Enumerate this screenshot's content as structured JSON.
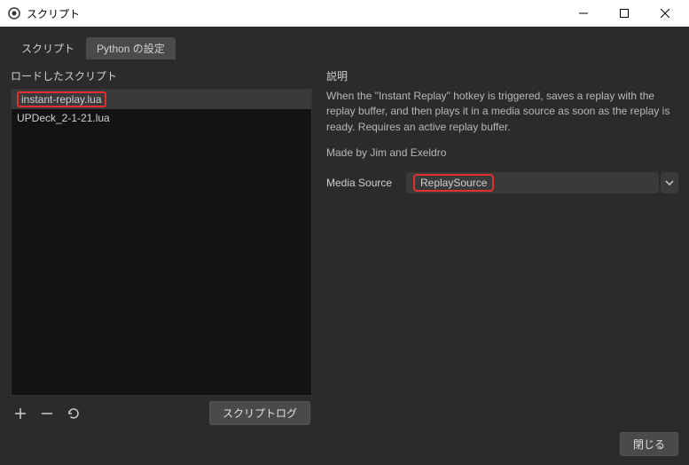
{
  "window": {
    "title": "スクリプト"
  },
  "tabs": {
    "scripts": "スクリプト",
    "python": "Python の設定"
  },
  "left": {
    "label": "ロードしたスクリプト",
    "items": [
      "instant-replay.lua",
      "UPDeck_2-1-21.lua"
    ]
  },
  "right": {
    "label": "説明",
    "description1": "When the \"Instant Replay\" hotkey is triggered, saves a replay with the replay buffer, and then plays it in a media source as soon as the replay is ready.  Requires an active replay buffer.",
    "description2": "Made by Jim and Exeldro",
    "mediaSource": {
      "label": "Media Source",
      "value": "ReplaySource"
    }
  },
  "buttons": {
    "scriptLog": "スクリプトログ",
    "close": "閉じる"
  }
}
